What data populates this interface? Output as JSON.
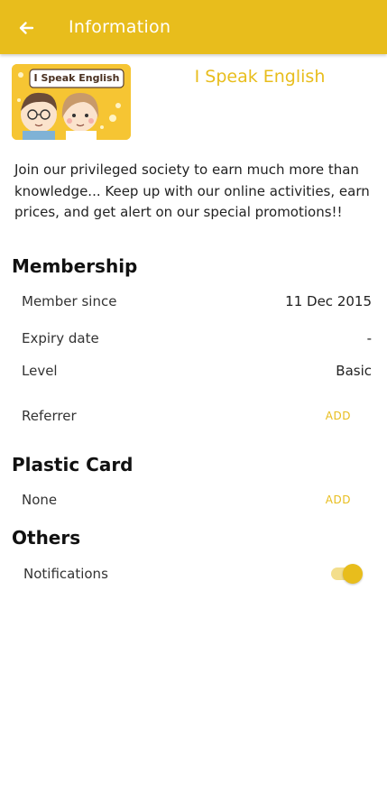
{
  "appbar": {
    "title": "Information",
    "back_icon": "arrow-left-icon"
  },
  "club": {
    "logo_text": "I Speak English",
    "name": "I Speak English",
    "description": "Join our privileged society to earn much more than knowledge... Keep up with our online activities, earn prices, and get alert on our special promotions!!"
  },
  "membership": {
    "title": "Membership",
    "member_since_label": "Member since",
    "member_since_value": "11 Dec 2015",
    "expiry_label": "Expiry date",
    "expiry_value": "-",
    "level_label": "Level",
    "level_value": "Basic",
    "referrer_label": "Referrer",
    "referrer_action": "ADD"
  },
  "plastic_card": {
    "title": "Plastic Card",
    "none_label": "None",
    "action": "ADD"
  },
  "others": {
    "title": "Others",
    "notifications_label": "Notifications",
    "notifications_on": true
  },
  "colors": {
    "accent": "#e8bd1c",
    "text": "#222222",
    "background": "#ffffff"
  }
}
